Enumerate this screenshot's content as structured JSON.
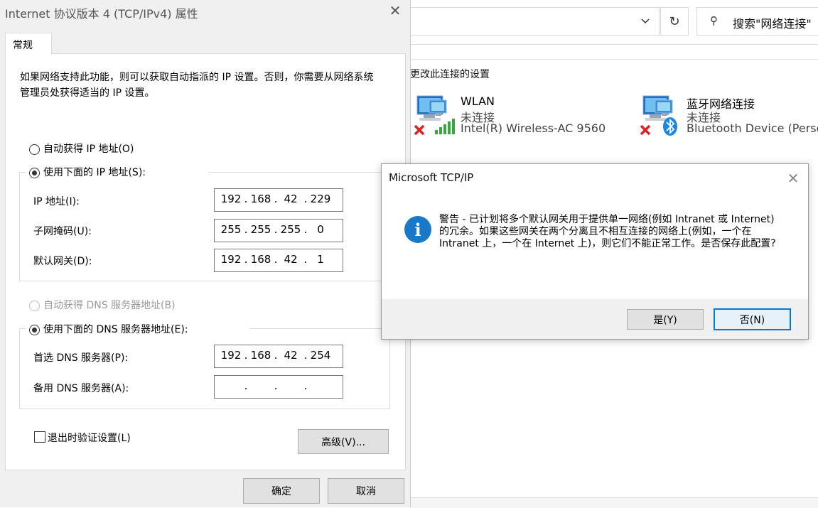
{
  "explorer": {
    "search_placeholder": "搜索\"网络连接\"",
    "command_label": "更改此连接的设置",
    "connections": [
      {
        "name": "WLAN",
        "status": "未连接",
        "device": "Intel(R) Wireless-AC 9560",
        "icon": "wifi-adapter-icon"
      },
      {
        "name": "蓝牙网络连接",
        "status": "未连接",
        "device": "Bluetooth Device (Person",
        "icon": "bluetooth-adapter-icon"
      }
    ]
  },
  "props": {
    "title": "Internet 协议版本 4 (TCP/IPv4) 属性",
    "tab_general": "常规",
    "description": "如果网络支持此功能，则可以获取自动指派的 IP 设置。否则，你需要从网络系统管理员处获得适当的 IP 设置。",
    "auto_ip_label": "自动获得 IP 地址(O)",
    "manual_ip_label": "使用下面的 IP 地址(S):",
    "ip_label": "IP 地址(I):",
    "ip": [
      "192",
      "168",
      "42",
      "229"
    ],
    "mask_label": "子网掩码(U):",
    "mask": [
      "255",
      "255",
      "255",
      "0"
    ],
    "gateway_label": "默认网关(D):",
    "gateway": [
      "192",
      "168",
      "42",
      "1"
    ],
    "auto_dns_label": "自动获得 DNS 服务器地址(B)",
    "manual_dns_label": "使用下面的 DNS 服务器地址(E):",
    "dns1_label": "首选 DNS 服务器(P):",
    "dns1": [
      "192",
      "168",
      "42",
      "254"
    ],
    "dns2_label": "备用 DNS 服务器(A):",
    "dns2": [
      "",
      "",
      "",
      ""
    ],
    "validate_label": "退出时验证设置(L)",
    "validate_checked": false,
    "advanced_button": "高级(V)...",
    "ok_button": "确定",
    "cancel_button": "取消"
  },
  "warning": {
    "title": "Microsoft TCP/IP",
    "message": "警告 - 已计划将多个默认网关用于提供单一网络(例如 Intranet 或 Internet)的冗余。如果这些网关在两个分离且不相互连接的网络上(例如，一个在 Intranet 上，一个在 Internet 上)，则它们不能正常工作。是否保存此配置?",
    "yes_button": "是(Y)",
    "no_button": "否(N)",
    "icon": "info-icon"
  },
  "colors": {
    "accent": "#0078d7",
    "info_icon": "#1a78c8",
    "error_x": "#e02020"
  }
}
